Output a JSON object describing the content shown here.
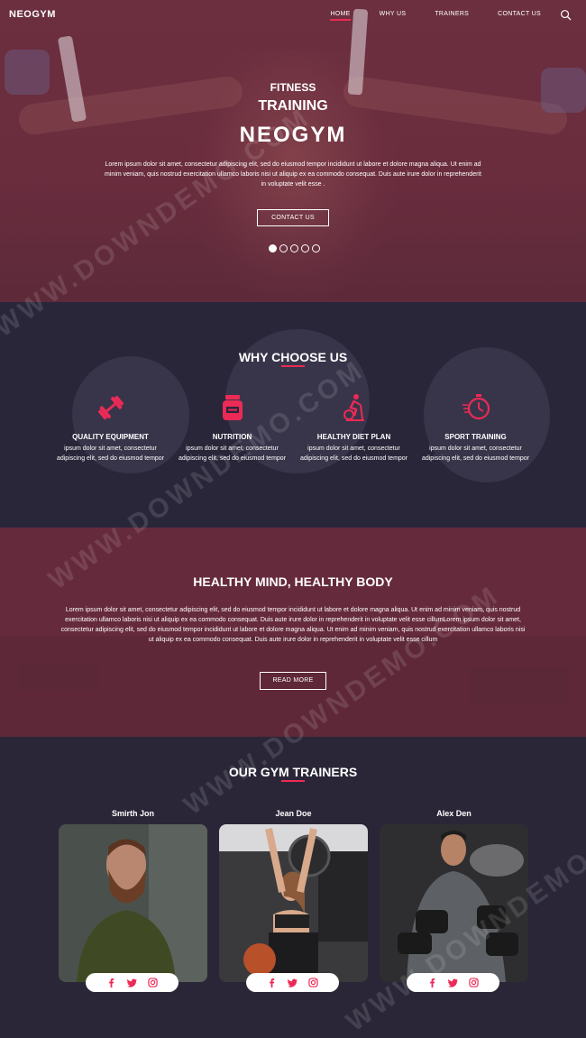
{
  "nav": {
    "logo": "NEOGYM",
    "items": [
      {
        "label": "HOME",
        "active": true
      },
      {
        "label": "WHY US",
        "active": false
      },
      {
        "label": "TRAINERS",
        "active": false
      },
      {
        "label": "CONTACT US",
        "active": false
      }
    ],
    "search_icon": "search-icon"
  },
  "hero": {
    "kicker": "FITNESS",
    "title": "TRAINING",
    "brand": "NEOGYM",
    "text": "Lorem ipsum dolor sit amet, consectetur adipiscing elit, sed do eiusmod tempor incididunt ut labore et dolore magna aliqua. Ut enim ad minim veniam, quis nostrud exercitation ullamco laboris nisi ut aliquip ex ea commodo consequat. Duis aute irure dolor in reprehenderit in voluptate velit esse .",
    "button": "CONTACT US",
    "slides": 5,
    "active_slide": 1
  },
  "why": {
    "title": "WHY CHOOSE US",
    "features": [
      {
        "icon": "dumbbell-icon",
        "title": "QUALITY EQUIPMENT",
        "text": "ipsum dolor sit amet, consectetur adipiscing elit, sed do eiusmod tempor"
      },
      {
        "icon": "supplement-jar-icon",
        "title": "NUTRITION",
        "text": "ipsum dolor sit amet, consectetur adipiscing elit, sed do eiusmod tempor"
      },
      {
        "icon": "exercise-bike-icon",
        "title": "HEALTHY DIET PLAN",
        "text": "ipsum dolor sit amet, consectetur adipiscing elit, sed do eiusmod tempor"
      },
      {
        "icon": "stopwatch-icon",
        "title": "SPORT TRAINING",
        "text": "ipsum dolor sit amet, consectetur adipiscing elit, sed do eiusmod tempor"
      }
    ]
  },
  "mind": {
    "title": "HEALTHY MIND, HEALTHY BODY",
    "text": "Lorem ipsum dolor sit amet, consectetur adipiscing elit, sed do eiusmod tempor incididunt ut labore et dolore magna aliqua. Ut enim ad minim veniam, quis nostrud exercitation ullamco laboris nisi ut aliquip ex ea commodo consequat. Duis aute irure dolor in reprehenderit in voluptate velit esse cillumLorem ipsum dolor sit amet, consectetur adipiscing elit, sed do eiusmod tempor incididunt ut labore et dolore magna aliqua. Ut enim ad minim veniam, quis nostrud exercitation ullamco laboris nisi ut aliquip ex ea commodo consequat. Duis aute irure dolor in reprehenderit in voluptate velit esse cillum",
    "button": "READ MORE"
  },
  "trainers": {
    "title": "OUR GYM TRAINERS",
    "people": [
      {
        "name": "Smirth Jon"
      },
      {
        "name": "Jean Doe"
      },
      {
        "name": "Alex Den"
      }
    ],
    "social_icons": [
      "facebook-icon",
      "twitter-icon",
      "instagram-icon"
    ]
  },
  "watermark": "WWW.DOWNDEMO.COM",
  "colors": {
    "accent": "#ec2a56",
    "hero_bg": "#6b2f3f",
    "dark_bg": "#29263a",
    "mind_bg": "#652a3c"
  }
}
